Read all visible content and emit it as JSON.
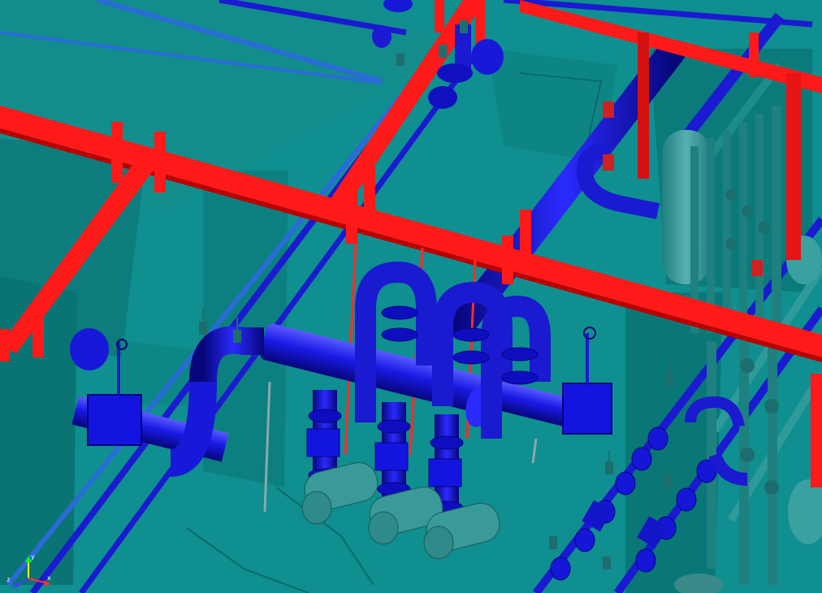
{
  "app": {
    "window_title": "",
    "view": "3D piping model"
  },
  "colors": {
    "background": "#0f8f8f",
    "floor_slab": "#1aa3a3",
    "floor_slab_dark": "#0c7d7d",
    "steel_red": "#ff1a1a",
    "steel_red_dark": "#c40000",
    "pipe_blue": "#1212e6",
    "pipe_blue_dark": "#08089a",
    "pipe_blue_light": "#3a3aff",
    "pipe_teal": "#1f8c8c",
    "tank_teal": "#3a9a9a",
    "hanger_gray": "#8aa",
    "valve_red": "#ff2a2a"
  },
  "axis_triad": {
    "x_label": "x",
    "y_label": "y",
    "z_label": "z"
  },
  "icons": {
    "triad": "axis-triad-icon"
  }
}
